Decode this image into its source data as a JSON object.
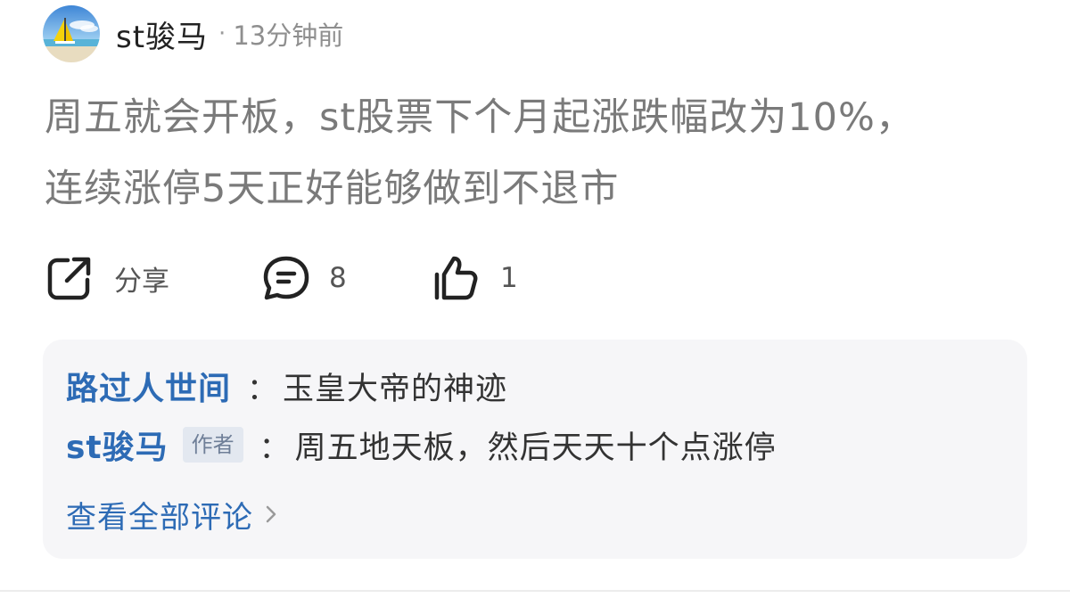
{
  "post": {
    "author": "st骏马",
    "separator": "·",
    "time": "13分钟前",
    "content_line1": "周五就会开板，st股票下个月起涨跌幅改为10%，",
    "content_line2": "连续涨停5天正好能够做到不退市"
  },
  "actions": {
    "share": {
      "icon": "share-icon",
      "label": "分享"
    },
    "comment": {
      "icon": "comment-icon",
      "count": "8"
    },
    "like": {
      "icon": "thumbs-up-icon",
      "count": "1"
    }
  },
  "comments": {
    "items": [
      {
        "user": "路过人世间",
        "separator": "：",
        "text": "玉皇大帝的神迹"
      },
      {
        "user": "st骏马",
        "badge": "作者",
        "separator": "：",
        "text": "周五地天板，然后天天十个点涨停"
      }
    ],
    "view_all_label": "查看全部评论",
    "view_all_icon": "chevron-right-icon"
  },
  "colors": {
    "link_blue": "#2d6bb5",
    "content_gray": "#7a7a7a",
    "comment_bg": "#f6f6f8"
  }
}
